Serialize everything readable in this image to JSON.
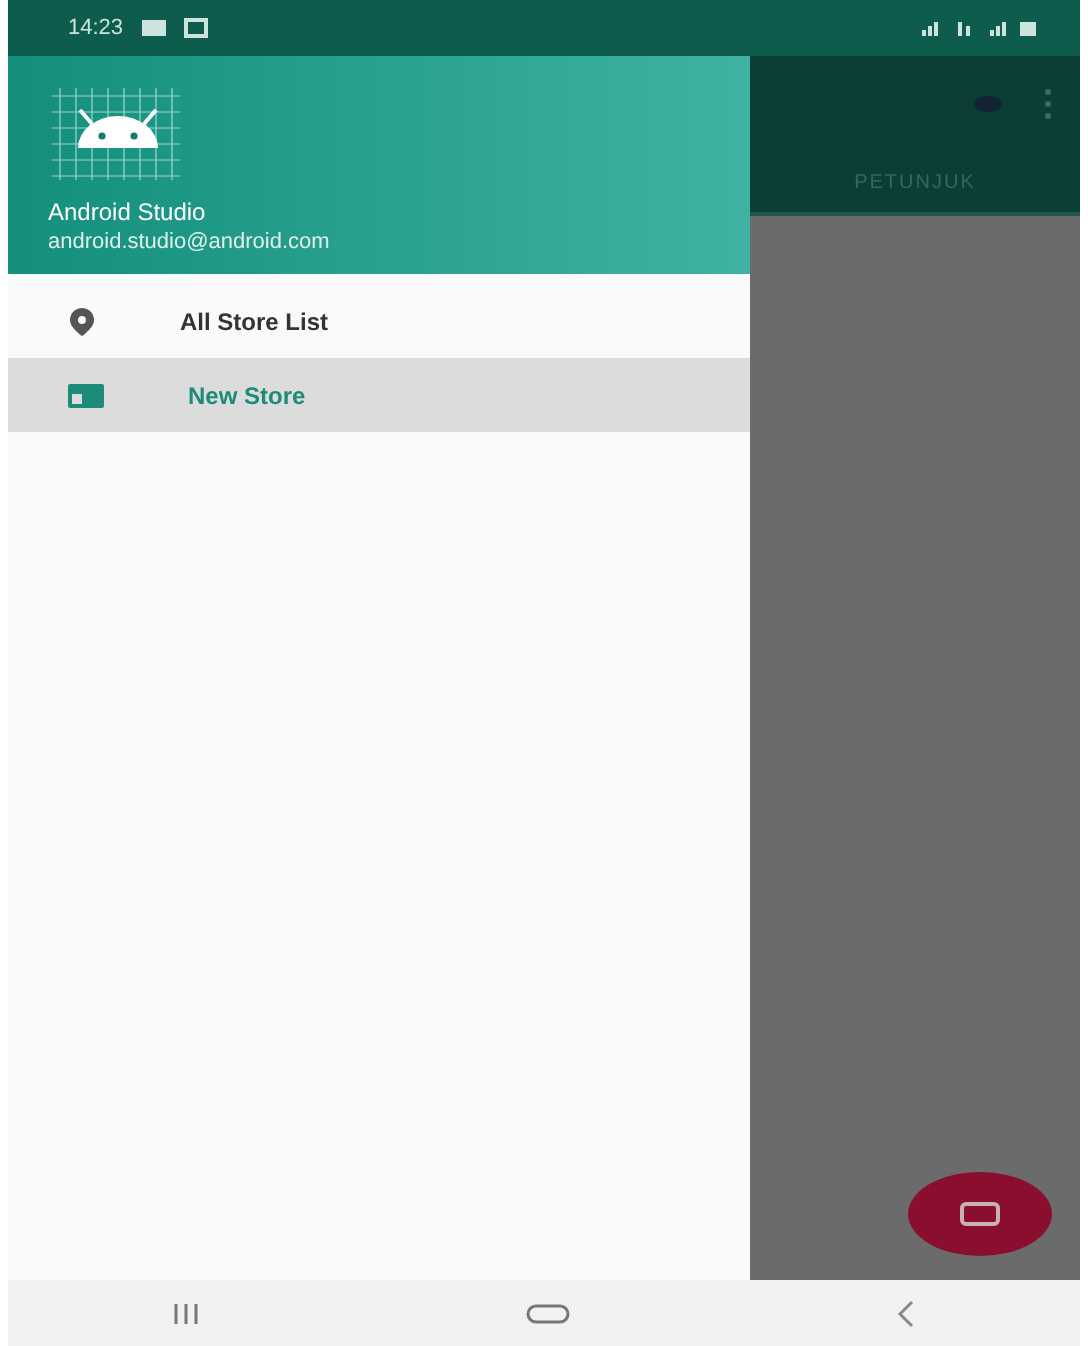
{
  "status_bar": {
    "time": "14:23"
  },
  "drawer": {
    "name": "Android Studio",
    "email": "android.studio@android.com",
    "items": [
      {
        "label": "All Store List",
        "selected": false
      },
      {
        "label": "New Store",
        "selected": true
      }
    ]
  },
  "app_bar": {
    "tabs": [
      {
        "label": "PETUNJUK",
        "selected": true
      }
    ]
  }
}
